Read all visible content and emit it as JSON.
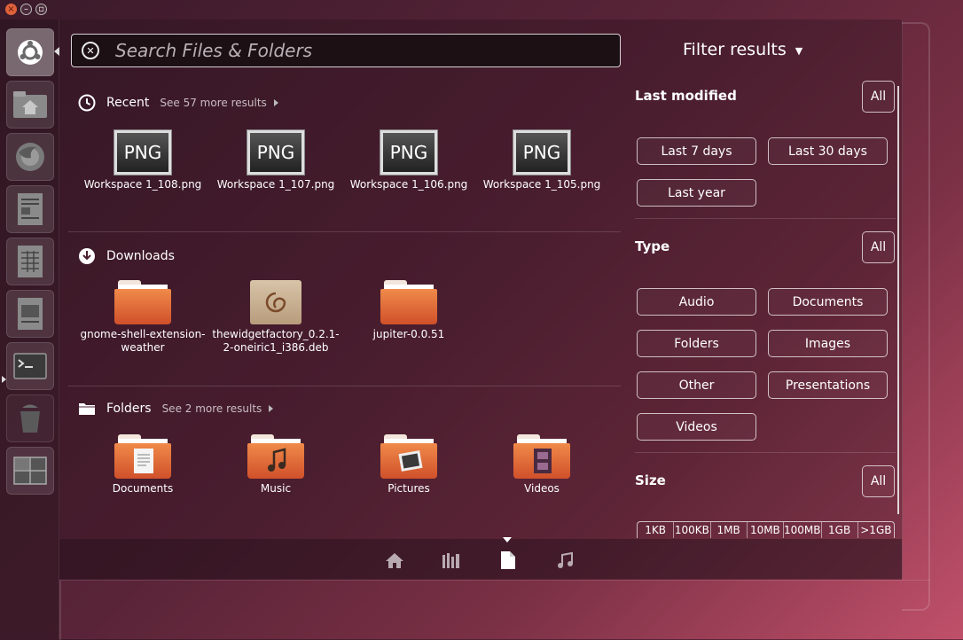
{
  "window_controls": {
    "close": "×",
    "minimize": "–",
    "maximize": "▫"
  },
  "launcher": {
    "items": [
      {
        "name": "dash-home",
        "icon": "ubuntu-logo-icon"
      },
      {
        "name": "home-folder",
        "icon": "home-folder-icon"
      },
      {
        "name": "firefox",
        "icon": "firefox-icon"
      },
      {
        "name": "libreoffice-writer",
        "icon": "writer-icon"
      },
      {
        "name": "libreoffice-calc",
        "icon": "calc-icon"
      },
      {
        "name": "libreoffice-impress",
        "icon": "impress-icon"
      },
      {
        "name": "terminal",
        "icon": "terminal-icon"
      },
      {
        "name": "trash",
        "icon": "trash-icon"
      },
      {
        "name": "workspace-switcher",
        "icon": "workspace-switcher-icon"
      }
    ]
  },
  "search": {
    "placeholder": "Search Files & Folders",
    "value": ""
  },
  "recent": {
    "title": "Recent",
    "more": "See 57 more results",
    "files": [
      {
        "label": "PNG",
        "name": "Workspace 1_108.png"
      },
      {
        "label": "PNG",
        "name": "Workspace 1_107.png"
      },
      {
        "label": "PNG",
        "name": "Workspace 1_106.png"
      },
      {
        "label": "PNG",
        "name": "Workspace 1_105.png"
      }
    ]
  },
  "downloads": {
    "title": "Downloads",
    "files": [
      {
        "name_line1": "gnome-shell-extension-",
        "name_line2": "weather"
      },
      {
        "name_line1": "thewidgetfactory_0.2.1-",
        "name_line2": "2-oneiric1_i386.deb"
      },
      {
        "name_line1": "jupiter-0.0.51",
        "name_line2": ""
      }
    ]
  },
  "folders": {
    "title": "Folders",
    "more": "See 2 more results",
    "items": [
      {
        "name": "Documents"
      },
      {
        "name": "Music"
      },
      {
        "name": "Pictures"
      },
      {
        "name": "Videos"
      }
    ]
  },
  "filter": {
    "title": "Filter results",
    "caret": "▼",
    "last_modified": {
      "title": "Last modified",
      "all": "All",
      "options": [
        "Last 7 days",
        "Last 30 days",
        "Last year"
      ]
    },
    "type": {
      "title": "Type",
      "all": "All",
      "options": [
        "Audio",
        "Documents",
        "Folders",
        "Images",
        "Other",
        "Presentations",
        "Videos"
      ]
    },
    "size": {
      "title": "Size",
      "all": "All",
      "options": [
        "1KB",
        "100KB",
        "1MB",
        "10MB",
        "100MB",
        "1GB",
        ">1GB"
      ]
    }
  },
  "lenses": [
    {
      "name": "home-lens",
      "icon": "home-icon",
      "active": false
    },
    {
      "name": "applications-lens",
      "icon": "applications-icon",
      "active": false
    },
    {
      "name": "files-lens",
      "icon": "file-icon",
      "active": true
    },
    {
      "name": "music-lens",
      "icon": "music-note-icon",
      "active": false
    }
  ],
  "colors": {
    "accent": "#e0623a",
    "folder_orange": "#e8743a"
  }
}
